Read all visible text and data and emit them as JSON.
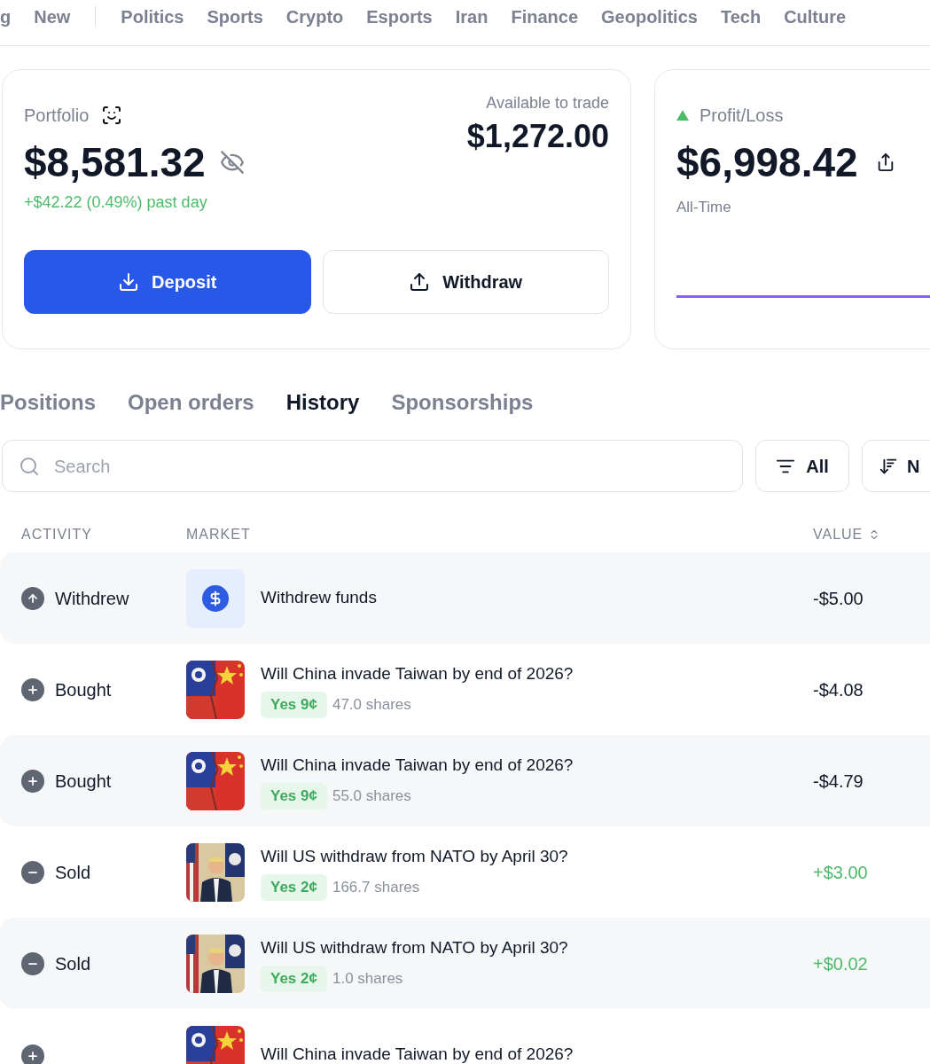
{
  "nav": {
    "leading": [
      "g",
      "New"
    ],
    "categories": [
      "Politics",
      "Sports",
      "Crypto",
      "Esports",
      "Iran",
      "Finance",
      "Geopolitics",
      "Tech",
      "Culture"
    ]
  },
  "portfolio": {
    "label": "Portfolio",
    "value": "$8,581.32",
    "change": "+$42.22 (0.49%) past day",
    "available_label": "Available to trade",
    "available_value": "$1,272.00",
    "deposit": "Deposit",
    "withdraw": "Withdraw"
  },
  "profit_loss": {
    "label": "Profit/Loss",
    "value": "$6,998.42",
    "period": "All-Time"
  },
  "tabs": [
    {
      "label": "Positions",
      "selected": false
    },
    {
      "label": "Open orders",
      "selected": false
    },
    {
      "label": "History",
      "selected": true
    },
    {
      "label": "Sponsorships",
      "selected": false
    }
  ],
  "search": {
    "placeholder": "Search"
  },
  "filter": {
    "label": "All"
  },
  "sort": {
    "label": "N"
  },
  "table": {
    "columns": [
      "ACTIVITY",
      "MARKET",
      "VALUE"
    ],
    "rows": [
      {
        "kind": "withdrew",
        "activity": "Withdrew",
        "thumb": {
          "kind": "dollar"
        },
        "market": "Withdrew funds",
        "value": "-$5.00",
        "positive": false
      },
      {
        "kind": "bought",
        "activity": "Bought",
        "thumb": {
          "kind": "flag"
        },
        "market": "Will China invade Taiwan by end of 2026?",
        "outcome": "Yes 9¢",
        "shares": "47.0 shares",
        "value": "-$4.08",
        "positive": false
      },
      {
        "kind": "bought",
        "activity": "Bought",
        "thumb": {
          "kind": "flag"
        },
        "market": "Will China invade Taiwan by end of 2026?",
        "outcome": "Yes 9¢",
        "shares": "55.0 shares",
        "value": "-$4.79",
        "positive": false
      },
      {
        "kind": "sold",
        "activity": "Sold",
        "thumb": {
          "kind": "person"
        },
        "market": "Will US withdraw from NATO by April 30?",
        "outcome": "Yes 2¢",
        "shares": "166.7 shares",
        "value": "+$3.00",
        "positive": true
      },
      {
        "kind": "sold",
        "activity": "Sold",
        "thumb": {
          "kind": "person"
        },
        "market": "Will US withdraw from NATO by April 30?",
        "outcome": "Yes 2¢",
        "shares": "1.0 shares",
        "value": "+$0.02",
        "positive": true
      },
      {
        "kind": "bought",
        "thumb": {
          "kind": "flag"
        },
        "market": "Will China invade Taiwan by end of 2026?"
      }
    ]
  }
}
